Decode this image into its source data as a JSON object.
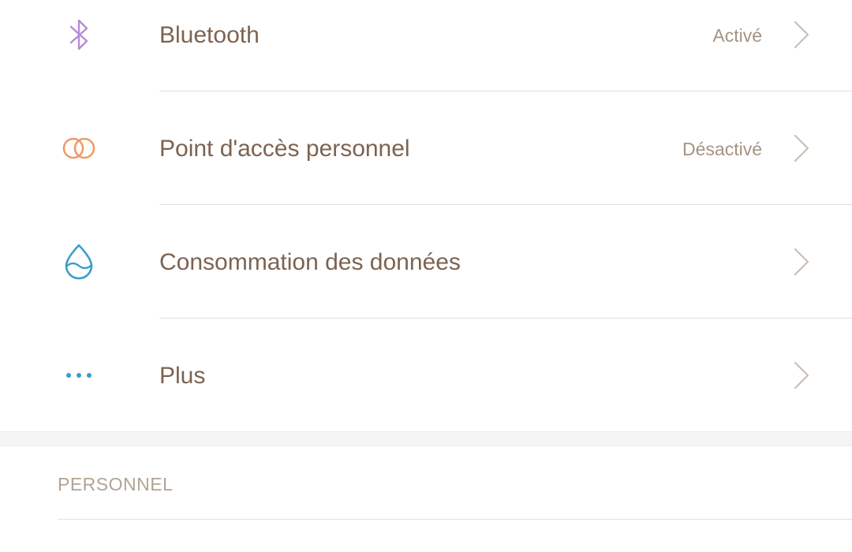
{
  "settings": {
    "items": [
      {
        "label": "Bluetooth",
        "value": "Activé",
        "icon": "bluetooth-icon",
        "icon_color": "#b78bd9"
      },
      {
        "label": "Point d'accès personnel",
        "value": "Désactivé",
        "icon": "hotspot-rings-icon",
        "icon_color": "#ef9a6c"
      },
      {
        "label": "Consommation des données",
        "value": "",
        "icon": "water-drop-icon",
        "icon_color": "#3a9dcc"
      },
      {
        "label": "Plus",
        "value": "",
        "icon": "more-dots-icon",
        "icon_color": "#3a9dcc"
      }
    ]
  },
  "section": {
    "title": "PERSONNEL"
  },
  "colors": {
    "label_text": "#7d6350",
    "value_text": "#a59383",
    "chevron": "#c9bfb6",
    "divider": "#e4e0dc"
  }
}
